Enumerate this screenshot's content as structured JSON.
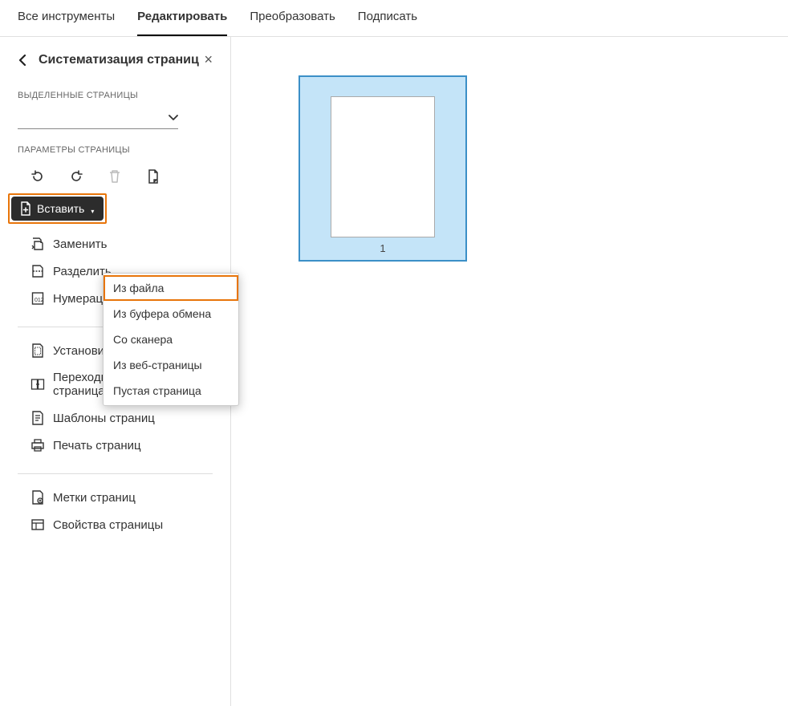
{
  "top_tabs": {
    "all_tools": "Все инструменты",
    "edit": "Редактировать",
    "convert": "Преобразовать",
    "sign": "Подписать"
  },
  "panel": {
    "title": "Систематизация страниц",
    "close": "×"
  },
  "sections": {
    "selected_pages": "ВЫДЕЛЕННЫЕ СТРАНИЦЫ",
    "page_params": "ПАРАМЕТРЫ СТРАНИЦЫ"
  },
  "insert_button": "Вставить",
  "commands": {
    "replace": "Заменить",
    "split": "Разделить",
    "numbering": "Нумерация",
    "set_margins": "Установить поля страницы",
    "transitions": "Переходы между страницами",
    "templates": "Шаблоны страниц",
    "print": "Печать страниц",
    "labels": "Метки страниц",
    "properties": "Свойства страницы"
  },
  "insert_menu": {
    "from_file": "Из файла",
    "from_clipboard": "Из буфера обмена",
    "from_scanner": "Со сканера",
    "from_webpage": "Из веб-страницы",
    "blank_page": "Пустая страница"
  },
  "pages": {
    "p1_number": "1"
  }
}
